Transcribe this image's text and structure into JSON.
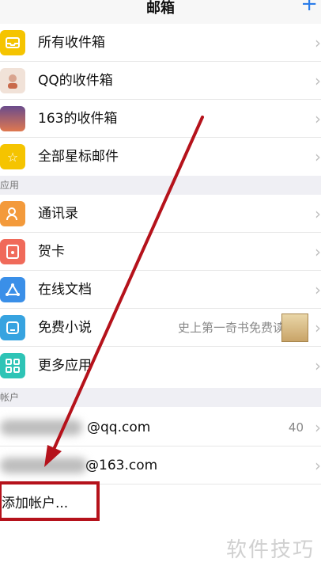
{
  "header": {
    "title": "邮箱",
    "add_icon": "+"
  },
  "mailboxes": [
    {
      "label": "所有收件箱",
      "icon": "inbox-icon",
      "color": "#f5c400"
    },
    {
      "label": "QQ的收件箱",
      "icon": "qq-avatar-icon",
      "color": "#f1e2d8"
    },
    {
      "label": "163的收件箱",
      "icon": "sunset-avatar-icon",
      "color": "#c96a4b"
    },
    {
      "label": "全部星标邮件",
      "icon": "star-icon",
      "color": "#f5c400"
    }
  ],
  "apps_section": {
    "label": "应用"
  },
  "apps": [
    {
      "label": "通讯录",
      "icon": "contacts-icon",
      "color": "#f39a3b"
    },
    {
      "label": "贺卡",
      "icon": "card-icon",
      "color": "#f06a5a"
    },
    {
      "label": "在线文档",
      "icon": "docs-icon",
      "color": "#3a8fe8"
    },
    {
      "label": "免费小说",
      "icon": "novel-icon",
      "color": "#37a3e0",
      "promo": "史上第一奇书免费读"
    },
    {
      "label": "更多应用",
      "icon": "grid-icon",
      "color": "#2ec4b6"
    }
  ],
  "accounts_section": {
    "label": "帐户"
  },
  "accounts": [
    {
      "label": "@qq.com",
      "count": "40"
    },
    {
      "label": "@163.com"
    }
  ],
  "add_account": {
    "label": "添加帐户..."
  },
  "watermark": "软件技巧",
  "colors": {
    "accent": "#2b7de9",
    "annotation": "#b5121b"
  }
}
